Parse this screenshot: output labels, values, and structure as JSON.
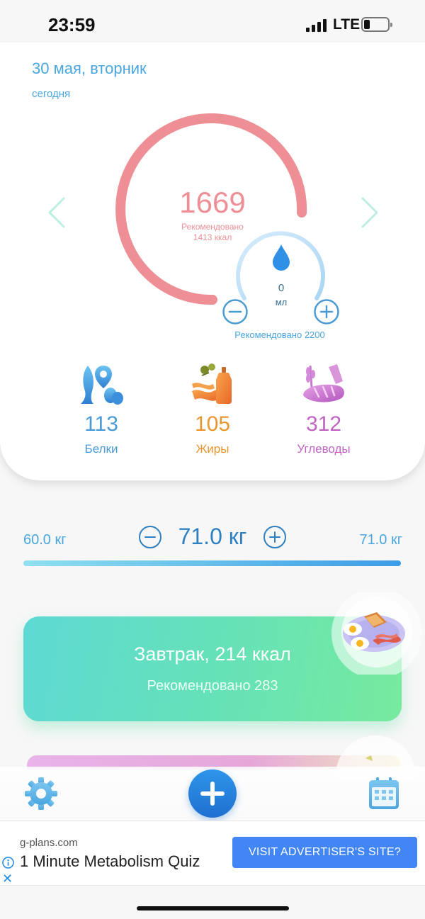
{
  "status_bar": {
    "time": "23:59",
    "network": "LTE"
  },
  "header": {
    "date": "30 мая, вторник",
    "subtitle": "сегодня"
  },
  "calories": {
    "value": "1669",
    "recommended_label": "Рекомендовано",
    "recommended_value": "1413 ккал",
    "gauge_color": "#ee8f95"
  },
  "water": {
    "value": "0",
    "unit": "мл",
    "recommended": "Рекомендовано 2200",
    "color": "#4aa6df"
  },
  "macros": [
    {
      "value": "113",
      "label": "Белки",
      "icon": "fish-egg-icon",
      "color": "#4a9ad4"
    },
    {
      "value": "105",
      "label": "Жиры",
      "icon": "bacon-oil-icon",
      "color": "#e8962e"
    },
    {
      "value": "312",
      "label": "Углеводы",
      "icon": "bread-wheat-icon",
      "color": "#c064c2"
    }
  ],
  "weight": {
    "min": "60.0 кг",
    "current": "71.0 кг",
    "max": "71.0 кг"
  },
  "meals": [
    {
      "title": "Завтрак, 214 ккал",
      "recommended": "Рекомендовано 283",
      "icon": "breakfast-plate-icon"
    }
  ],
  "tabbar": {
    "settings_icon": "gear-icon",
    "add_icon": "plus-icon",
    "calendar_icon": "calendar-icon"
  },
  "ad": {
    "domain": "g-plans.com",
    "title": "1 Minute Metabolism Quiz",
    "button": "VISIT ADVERTISER'S SITE?"
  }
}
